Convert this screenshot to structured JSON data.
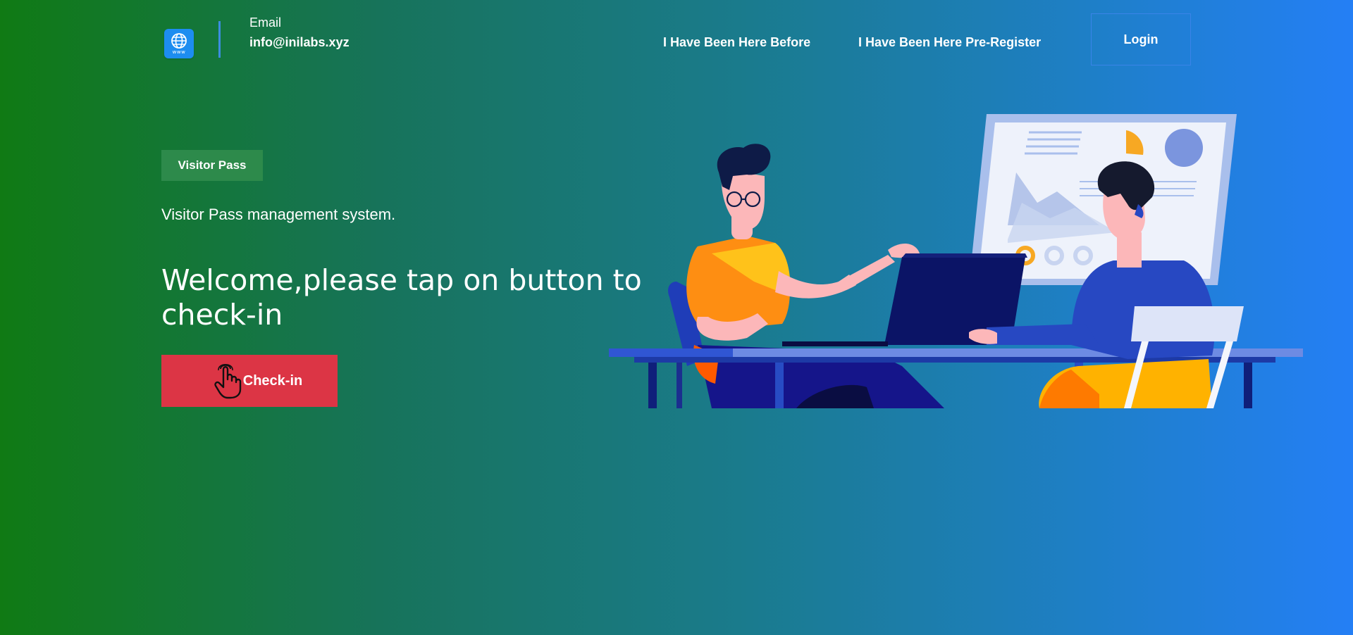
{
  "header": {
    "logo_icon": "globe-www-icon",
    "logo_text": "www",
    "email_label": "Email",
    "email_value": "info@inilabs.xyz",
    "nav": {
      "been_here_before": "I Have Been Here Before",
      "been_here_preregister": "I Have Been Here Pre-Register"
    },
    "login_label": "Login"
  },
  "hero": {
    "badge": "Visitor Pass",
    "subtitle": "Visitor Pass management system.",
    "headline": "Welcome,please tap on button to check-in",
    "checkin_label": "Check-in",
    "checkin_icon": "hand-pointer-icon",
    "illustration": "two-people-at-desk-illustration"
  },
  "colors": {
    "gradient_start": "#107a14",
    "gradient_end": "#247ff5",
    "checkin_button": "#dc3545",
    "badge_bg": "#2d8a4b",
    "logo_bg": "#1d8df0"
  }
}
